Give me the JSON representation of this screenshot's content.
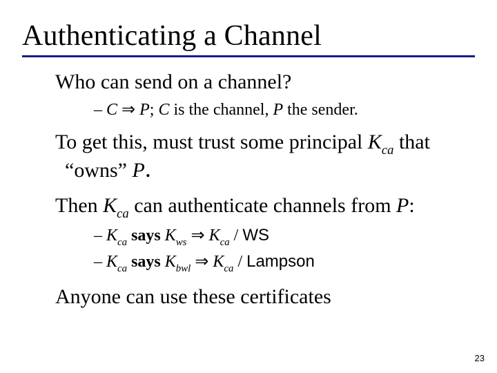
{
  "title": "Authenticating a Channel",
  "line1": "Who can send on a channel?",
  "sub1": {
    "dash": "– ",
    "C": "C",
    "arrow": " ⇒ ",
    "P": "P",
    "rest1": "; ",
    "C2": "C",
    "rest2": " is the channel, ",
    "P2": "P",
    "rest3": " the sender."
  },
  "line2": {
    "a": "To get this, must trust some principal ",
    "K": "K",
    "ca": "ca",
    "b": " that “owns” ",
    "P": "P"
  },
  "line3": {
    "a": "Then ",
    "K": "K",
    "ca": "ca",
    "b": " can authenticate channels from ",
    "P": "P",
    "c": ":"
  },
  "sub2": {
    "dash": "– ",
    "K1": "K",
    "ca1": "ca",
    "says": "  says ",
    "K2": "K",
    "ws": "ws",
    "arrow": "  ⇒ ",
    "K3": "K",
    "ca3": "ca",
    "slash": " / ",
    "WS": "WS"
  },
  "sub3": {
    "dash": "– ",
    "K1": "K",
    "ca1": "ca",
    "says": "  says ",
    "K2": "K",
    "bwl": "bwl",
    "arrow": " ⇒ ",
    "K3": "K",
    "ca3": "ca",
    "slash": " / ",
    "Lampson": "Lampson"
  },
  "line4": "Anyone can use these certificates",
  "page": "23"
}
